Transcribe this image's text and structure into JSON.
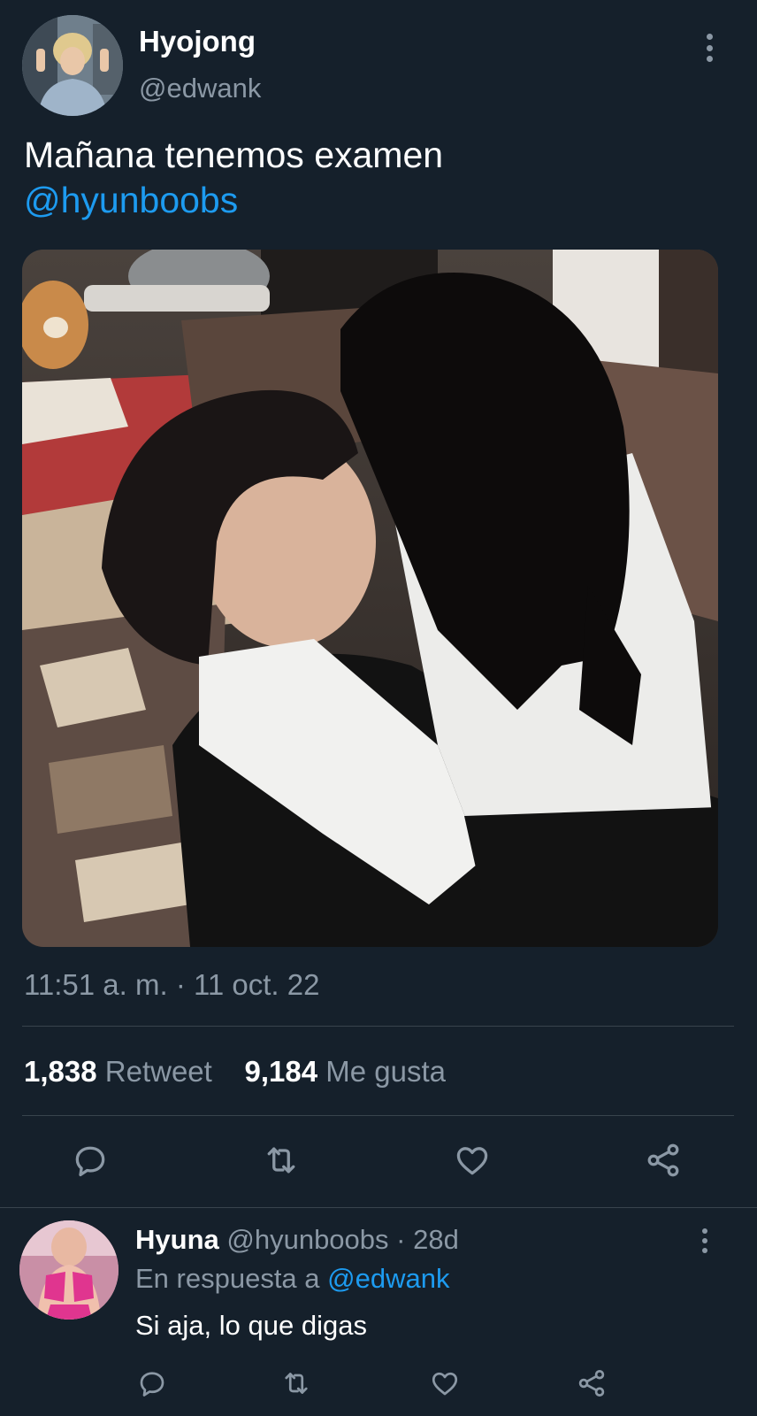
{
  "tweet": {
    "author": {
      "display_name": "Hyojong",
      "handle": "@edwank"
    },
    "text": "Mañana tenemos examen",
    "mention": "@hyunboobs",
    "timestamp": "11:51 a. m. · 11 oct. 22",
    "stats": {
      "retweets_count": "1,838",
      "retweets_label": "Retweet",
      "likes_count": "9,184",
      "likes_label": "Me gusta"
    },
    "actions": [
      "reply-icon",
      "retweet-icon",
      "like-icon",
      "share-icon"
    ]
  },
  "reply": {
    "author": {
      "display_name": "Hyuna",
      "handle": "@hyunboobs",
      "age": "· 28d"
    },
    "in_reply_prefix": "En respuesta a",
    "in_reply_to": "@edwank",
    "text": "Si aja, lo que digas",
    "actions": [
      "reply-icon",
      "retweet-icon",
      "like-icon",
      "share-icon"
    ]
  },
  "colors": {
    "background": "#15202b",
    "accent": "#1d9bf0",
    "secondary_text": "#8b98a5",
    "divider": "#38444d"
  }
}
